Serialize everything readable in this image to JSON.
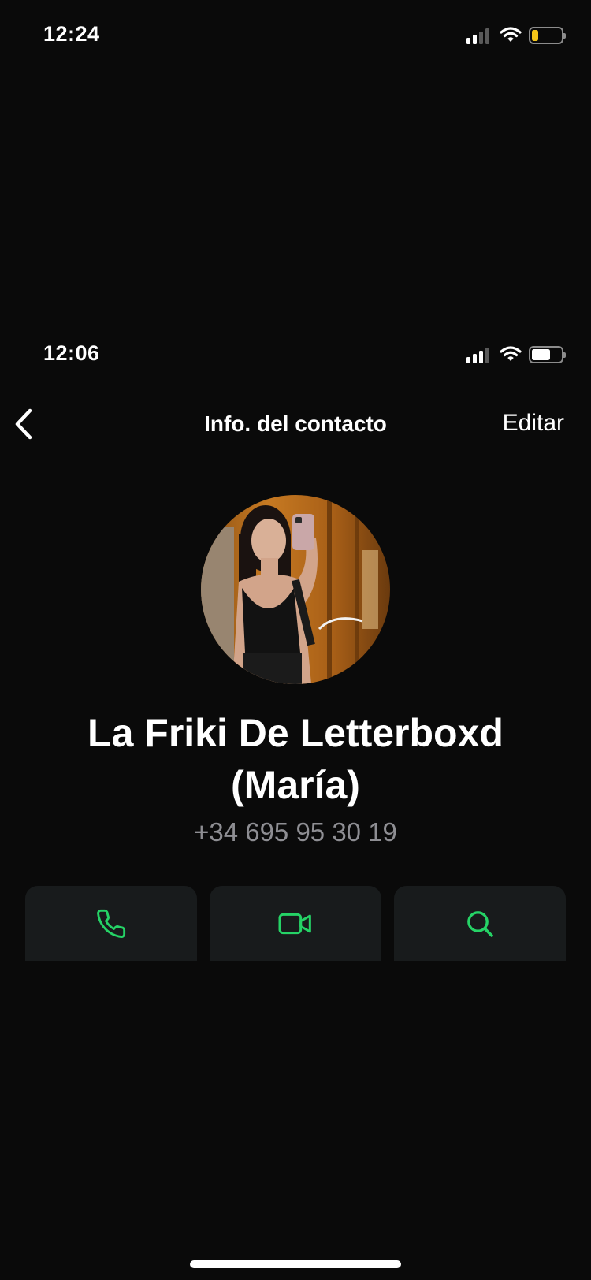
{
  "outer_status": {
    "time": "12:24",
    "battery_color": "#f5c518"
  },
  "inner_status": {
    "time": "12:06",
    "battery_color": "#ffffff"
  },
  "nav": {
    "back_icon": "chevron-left-icon",
    "title": "Info. del contacto",
    "edit_label": "Editar"
  },
  "contact": {
    "name_line1": "La Friki De Letterboxd",
    "name_line2": "(María)",
    "phone": "+34 695 95 30 19"
  },
  "actions": [
    {
      "icon": "phone-icon"
    },
    {
      "icon": "video-camera-icon"
    },
    {
      "icon": "search-icon"
    }
  ],
  "colors": {
    "background": "#0a0a0a",
    "accent": "#25d366",
    "card": "#181b1c",
    "secondary_text": "#8e8e93"
  }
}
